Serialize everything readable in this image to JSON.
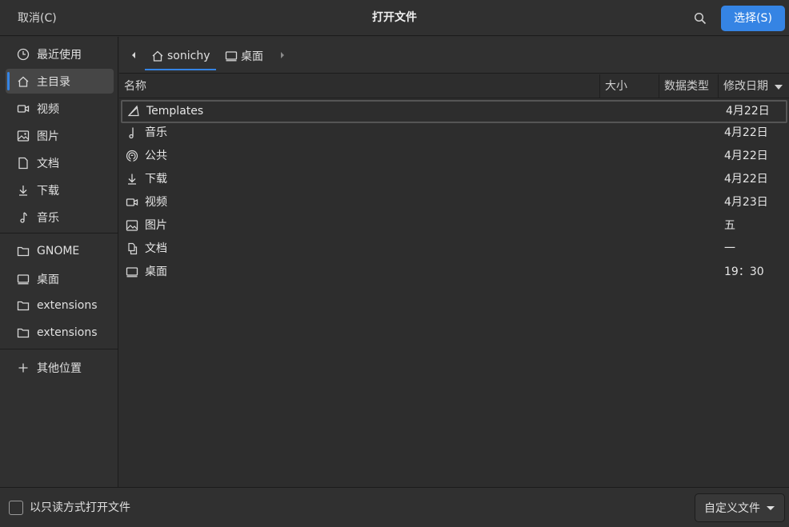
{
  "header": {
    "cancel_label": "取消(C)",
    "title": "打开文件",
    "select_label": "选择(S)"
  },
  "sidebar": {
    "items": [
      {
        "label": "最近使用",
        "icon": "clock-icon"
      },
      {
        "label": "主目录",
        "icon": "home-icon"
      },
      {
        "label": "视频",
        "icon": "video-icon"
      },
      {
        "label": "图片",
        "icon": "image-icon"
      },
      {
        "label": "文档",
        "icon": "document-icon"
      },
      {
        "label": "下载",
        "icon": "download-icon"
      },
      {
        "label": "音乐",
        "icon": "music-icon"
      },
      {
        "label": "GNOME",
        "icon": "folder-icon"
      },
      {
        "label": "桌面",
        "icon": "desktop-icon"
      },
      {
        "label": "extensions",
        "icon": "folder-icon"
      },
      {
        "label": "extensions",
        "icon": "folder-icon"
      },
      {
        "label": "其他位置",
        "icon": "plus-icon"
      }
    ],
    "active_index": 1
  },
  "pathbar": {
    "crumbs": [
      {
        "label": "sonichy",
        "icon": "home-icon"
      },
      {
        "label": "桌面",
        "icon": "desktop-icon"
      }
    ]
  },
  "columns": {
    "name": "名称",
    "size": "大小",
    "type": "数据类型",
    "modified": "修改日期"
  },
  "files": [
    {
      "name": "Templates",
      "date": "4月22日",
      "icon": "template-icon"
    },
    {
      "name": "音乐",
      "date": "4月22日",
      "icon": "music-icon"
    },
    {
      "name": "公共",
      "date": "4月22日",
      "icon": "share-icon"
    },
    {
      "name": "下载",
      "date": "4月22日",
      "icon": "download-icon"
    },
    {
      "name": "视频",
      "date": "4月23日",
      "icon": "video-icon"
    },
    {
      "name": "图片",
      "date": "五",
      "icon": "image-icon"
    },
    {
      "name": "文档",
      "date": "一",
      "icon": "documents-icon"
    },
    {
      "name": "桌面",
      "date": "19：30",
      "icon": "desktop-icon"
    }
  ],
  "footer": {
    "readonly_label": "以只读方式打开文件",
    "readonly_checked": false,
    "filter_label": "自定义文件"
  },
  "colors": {
    "accent": "#3584e4",
    "background": "#2d2d2d",
    "header": "#303030"
  }
}
